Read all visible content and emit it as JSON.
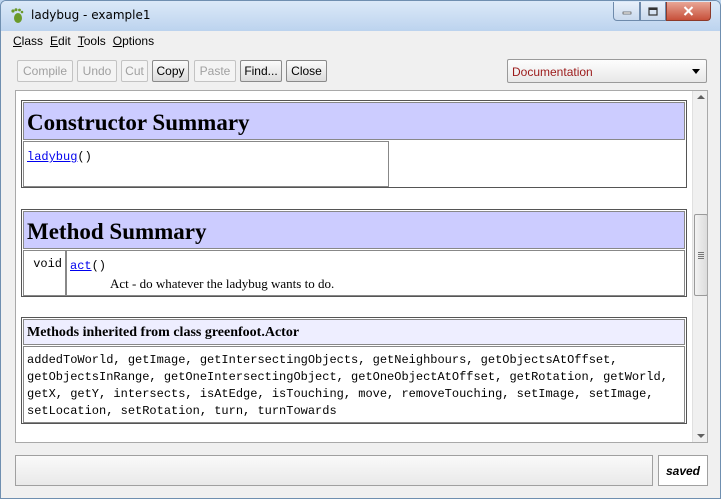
{
  "window": {
    "title": "ladybug - example1",
    "icon": "greenfoot-foot-icon"
  },
  "menu": {
    "items": [
      {
        "label": "Class"
      },
      {
        "label": "Edit"
      },
      {
        "label": "Tools"
      },
      {
        "label": "Options"
      }
    ]
  },
  "toolbar": {
    "compile": "Compile",
    "undo": "Undo",
    "cut": "Cut",
    "copy": "Copy",
    "paste": "Paste",
    "find": "Find...",
    "close": "Close"
  },
  "view_selector": {
    "selected": "Documentation"
  },
  "doc": {
    "constructor_summary": {
      "heading": "Constructor Summary",
      "constructor_name": "ladybug",
      "constructor_params": "()"
    },
    "method_summary": {
      "heading": "Method Summary",
      "return_type": "void",
      "method_name": "act",
      "method_params": "()",
      "description": "Act - do whatever the ladybug wants to do."
    },
    "inherited": {
      "heading": "Methods inherited from class greenfoot.Actor",
      "lines": [
        "addedToWorld, getImage, getIntersectingObjects, getNeighbours, getObjectsAtOffset,",
        "getObjectsInRange, getOneIntersectingObject, getOneObjectAtOffset, getRotation, getWorld,",
        "getX, getY, intersects, isAtEdge, isTouching, move, removeTouching, setImage, setImage,",
        "setLocation, setRotation, turn, turnTowards"
      ]
    }
  },
  "status": {
    "message": "",
    "saved_label": "saved"
  },
  "colors": {
    "header_bg": "#ccccff",
    "inherited_header_bg": "#eeeeff",
    "link": "#0000ee",
    "combo_text": "#9b1a1a"
  }
}
